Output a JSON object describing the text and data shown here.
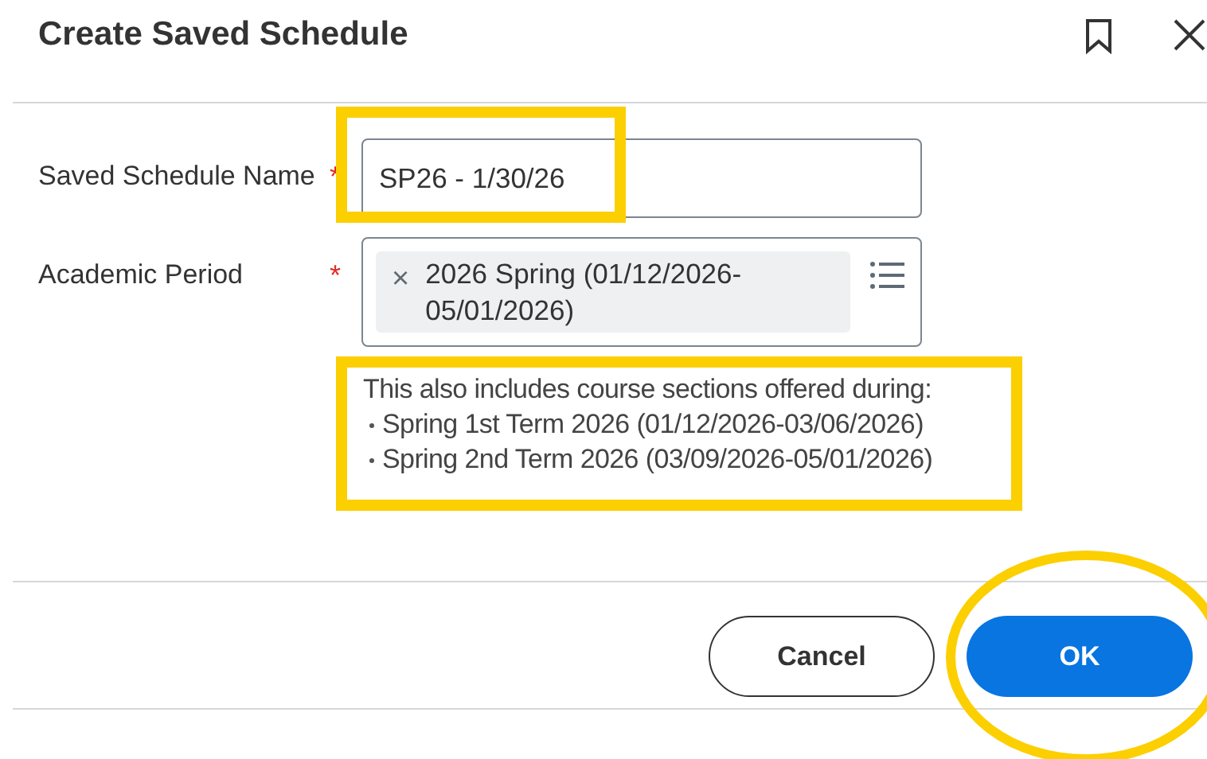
{
  "dialog": {
    "title": "Create Saved Schedule"
  },
  "fields": [
    {
      "kind": "text",
      "label": "Saved Schedule Name",
      "required_mark": "*",
      "value": "SP26 - 1/30/26",
      "highlighted": true
    },
    {
      "kind": "multiselect",
      "label": "Academic Period",
      "required_mark": "*",
      "remove_glyph": "×",
      "value": "2026 Spring (01/12/2026-05/01/2026)",
      "highlighted": false
    }
  ],
  "note": {
    "text": "This also includes course sections offered during:",
    "items": [
      "Spring 1st Term 2026 (01/12/2026-03/06/2026)",
      "Spring 2nd Term 2026 (03/09/2026-05/01/2026)"
    ],
    "highlighted": true
  },
  "buttons": [
    {
      "label": "Cancel",
      "kind": "secondary",
      "highlighted": false
    },
    {
      "label": "OK",
      "kind": "primary",
      "highlighted": true
    }
  ]
}
